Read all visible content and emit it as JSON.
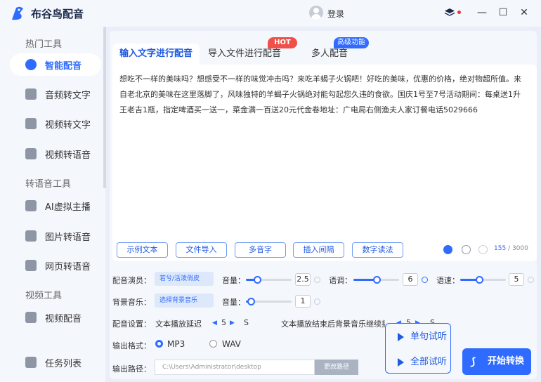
{
  "app": {
    "title": "布谷鸟配音",
    "login_label": "登录",
    "accent": "#2f6bff",
    "hot_color": "#f0504a"
  },
  "window": {
    "minimize": "—",
    "maximize": "☐",
    "close": "✕"
  },
  "sidebar": {
    "section_hot": "热门工具",
    "section_tts": "转语音工具",
    "section_video": "视频工具",
    "items": [
      {
        "label": "智能配音",
        "icon": "mic-icon"
      },
      {
        "label": "音频转文字",
        "icon": "audio-text-icon"
      },
      {
        "label": "视频转文字",
        "icon": "video-text-icon"
      },
      {
        "label": "视频转语音",
        "icon": "video-icon"
      },
      {
        "label": "AI虚拟主播",
        "icon": "avatar-icon"
      },
      {
        "label": "图片转语音",
        "icon": "image-icon"
      },
      {
        "label": "网页转语音",
        "icon": "globe-icon"
      },
      {
        "label": "视频配音",
        "icon": "film-icon"
      },
      {
        "label": "任务列表",
        "icon": "list-icon"
      }
    ]
  },
  "tabs": [
    {
      "label": "输入文字进行配音"
    },
    {
      "label": "导入文件进行配音",
      "badge": "HOT"
    },
    {
      "label": "多人配音",
      "badge": "高级功能"
    }
  ],
  "editor": {
    "text": "想吃不一样的美味吗？想感受不一样的味觉冲击吗？来吃羊蝎子火锅吧！好吃的美味，优惠的价格，绝对物超所值。来自老北京的美味在这里落脚了，风味独特的羊蝎子火锅绝对能勾起您久违的食欲。国庆1号至7号活动期间：每桌送1升王老吉1瓶，指定啤酒买一送一，菜金满一百送20元代金卷地址：广电局右侧渔夫人家订餐电话5029666",
    "char_count": "155",
    "char_limit": "/ 3000"
  },
  "toolbar": [
    "示例文本",
    "文件导入",
    "多音字",
    "插入间隔",
    "数字读法"
  ],
  "settings": {
    "voice_label": "配音演员：",
    "voice_value": "若兮/活泼俏皮",
    "volume_label": "音量：",
    "volume_value": "2.5",
    "volume_level": 0.25,
    "pitch_label": "语调：",
    "pitch_value": "6",
    "pitch_level": 0.5,
    "speed_label": "语速：",
    "speed_value": "5",
    "speed_level": 0.42,
    "bgm_label": "背景音乐：",
    "bgm_value": "选择背景音乐",
    "bgm_volume_label": "音量：",
    "bgm_volume_value": "1",
    "bgm_volume_level": 0.1,
    "config_label": "配音设置：",
    "delay_label": "文本播放延迟",
    "delay_value": "5",
    "delay_unit": "S",
    "tail_label": "文本播放结束后背景音乐继续播放",
    "tail_value": "5",
    "tail_unit": "S",
    "format_label": "输出格式：",
    "format_options": [
      "MP3",
      "WAV"
    ],
    "format_selected": "MP3",
    "path_label": "输出路径：",
    "path_value": "C:\\Users\\Administrator\\desktop",
    "change_path": "更改路径"
  },
  "actions": {
    "preview_sentence": "单句试听",
    "preview_all": "全部试听",
    "start": "开始转换"
  }
}
